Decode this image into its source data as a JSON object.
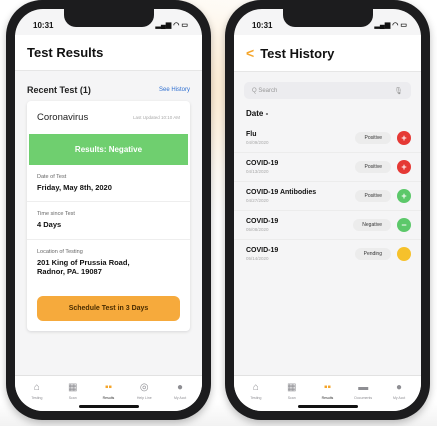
{
  "colors": {
    "accent": "#f5a52a",
    "negative_banner": "#6fcf6f",
    "positive": "#e53935",
    "negative": "#5cc86a",
    "pending": "#f6c12b",
    "link": "#2f6fd0"
  },
  "left": {
    "status_time": "10:31",
    "title": "Test Results",
    "recent_label": "Recent Test (1)",
    "see_history": "See History",
    "card": {
      "test_name": "Coronavirus",
      "updated": "Last Updated 10:10 AM",
      "result": "Results: Negative",
      "fields": [
        {
          "label": "Date of Test",
          "value": "Friday, May 8th, 2020"
        },
        {
          "label": "Time since Test",
          "value": "4 Days"
        },
        {
          "label": "Location of Testing",
          "value": "201 King of Prussia Road,\nRadnor, PA. 19087"
        }
      ],
      "cta": "Schedule Test in 3 Days"
    },
    "tabs": [
      {
        "icon": "home-icon",
        "label": "Testing"
      },
      {
        "icon": "scan-icon",
        "label": "Scan"
      },
      {
        "icon": "results-icon",
        "label": "Results",
        "active": true
      },
      {
        "icon": "help-icon",
        "label": "Help Line"
      },
      {
        "icon": "profile-icon",
        "label": "My Acct"
      }
    ]
  },
  "right": {
    "status_time": "10:31",
    "back": "<",
    "title": "Test History",
    "search_placeholder": "Q Search",
    "date_header": "Date -",
    "rows": [
      {
        "name": "Flu",
        "date": "04/09/2020",
        "status": "Positive",
        "state": "positive",
        "symbol": "+"
      },
      {
        "name": "COVID-19",
        "date": "04/13/2020",
        "status": "Positive",
        "state": "positive",
        "symbol": "+"
      },
      {
        "name": "COVID-19 Antibodies",
        "date": "04/27/2020",
        "status": "Positive",
        "state": "negative",
        "symbol": "+"
      },
      {
        "name": "COVID-19",
        "date": "05/08/2020",
        "status": "Negative",
        "state": "negative",
        "symbol": "−"
      },
      {
        "name": "COVID-19",
        "date": "05/14/2020",
        "status": "Pending",
        "state": "pending",
        "symbol": ""
      }
    ],
    "tabs": [
      {
        "icon": "home-icon",
        "label": "Testing"
      },
      {
        "icon": "scan-icon",
        "label": "Scan"
      },
      {
        "icon": "results-icon",
        "label": "Results",
        "active": true
      },
      {
        "icon": "documents-icon",
        "label": "Documents"
      },
      {
        "icon": "profile-icon",
        "label": "My Acct"
      }
    ]
  }
}
